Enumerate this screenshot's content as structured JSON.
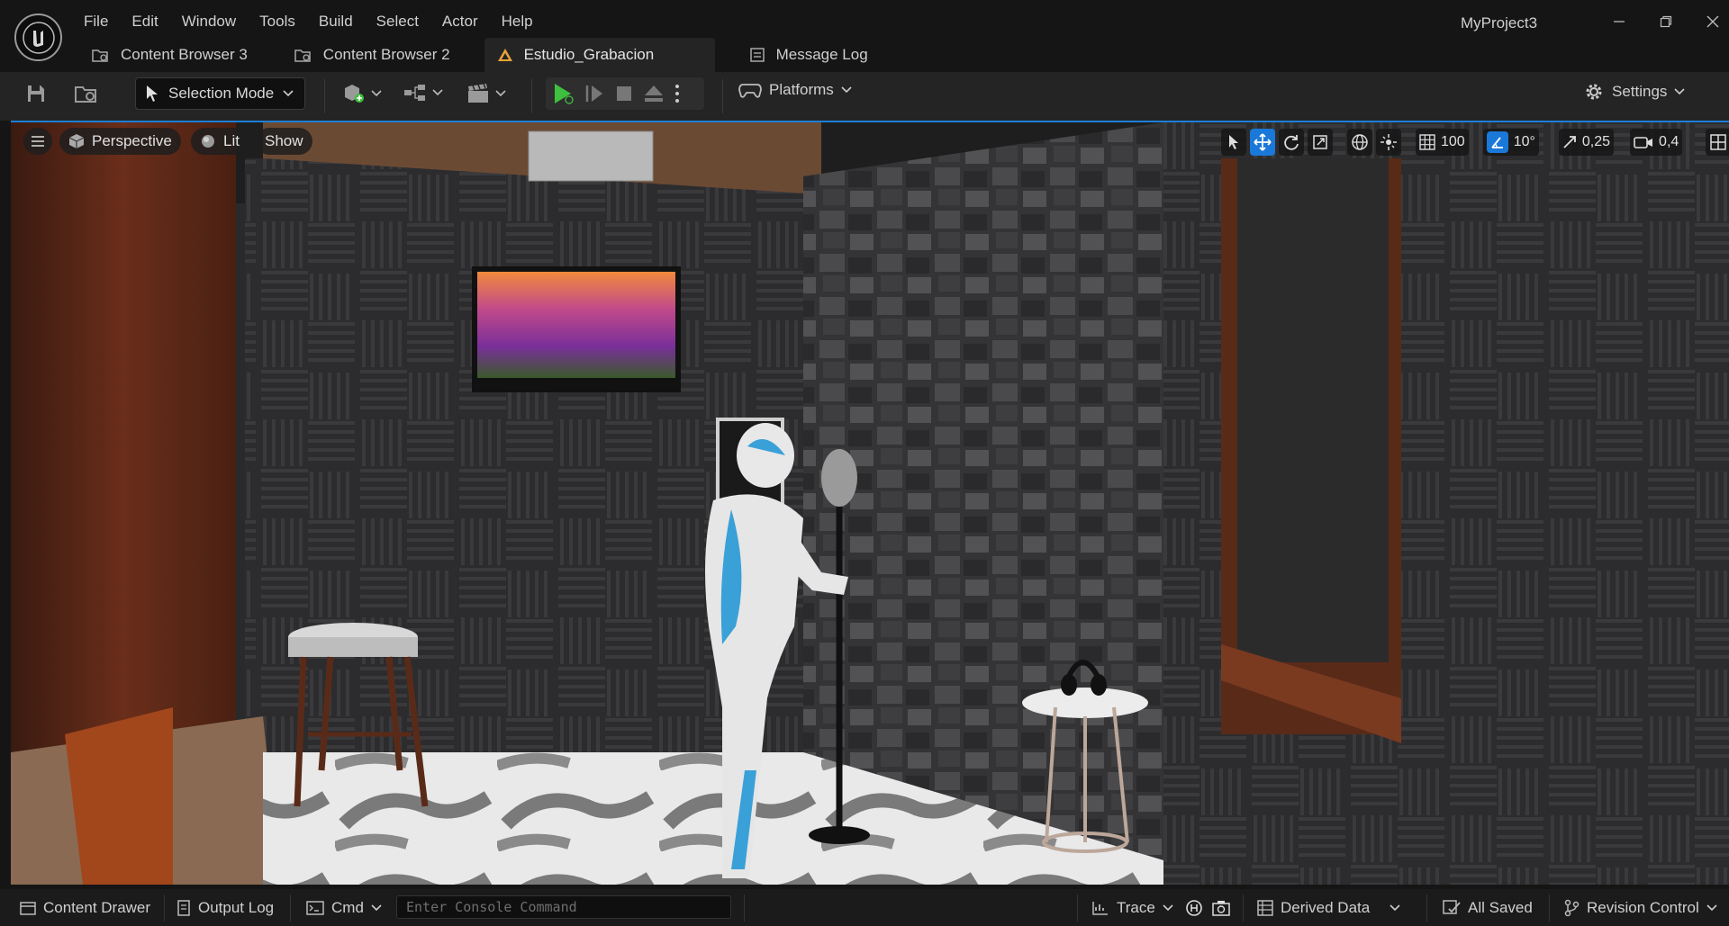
{
  "app": {
    "project_name": "MyProject3",
    "menu": [
      "File",
      "Edit",
      "Window",
      "Tools",
      "Build",
      "Select",
      "Actor",
      "Help"
    ],
    "tabs": [
      {
        "label": "Content Browser 3",
        "icon": "content-browser-icon",
        "active": false
      },
      {
        "label": "Content Browser 2",
        "icon": "content-browser-icon",
        "active": false
      },
      {
        "label": "Estudio_Grabacion",
        "icon": "level-icon",
        "active": true
      },
      {
        "label": "Message Log",
        "icon": "message-log-icon",
        "active": false
      }
    ]
  },
  "toolbar": {
    "selection_mode": "Selection Mode",
    "platforms": "Platforms",
    "settings": "Settings"
  },
  "viewport": {
    "perspective": "Perspective",
    "lit": "Lit",
    "show": "Show",
    "grid_snap": "100",
    "rotation_snap": "10°",
    "scale_snap": "0,25",
    "camera_speed": "0,4"
  },
  "statusbar": {
    "content_drawer": "Content Drawer",
    "output_log": "Output Log",
    "cmd": "Cmd",
    "console_placeholder": "Enter Console Command",
    "trace": "Trace",
    "derived_data": "Derived Data",
    "all_saved": "All Saved",
    "revision_control": "Revision Control"
  },
  "colors": {
    "accent_blue": "#1a78d8",
    "play_green": "#3fbf3f",
    "background": "#151515",
    "toolbar": "#242424"
  }
}
